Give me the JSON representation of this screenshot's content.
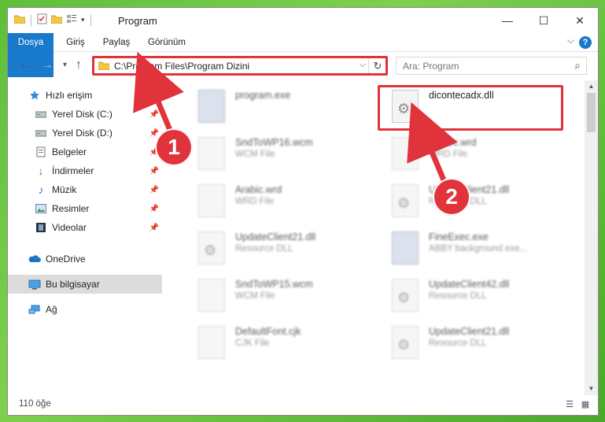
{
  "window": {
    "title": "Program",
    "controls": {
      "minimize": "—",
      "maximize": "☐",
      "close": "✕"
    }
  },
  "ribbon": {
    "tabs": [
      "Dosya",
      "Giriş",
      "Paylaş",
      "Görünüm"
    ],
    "help": "?",
    "expand_chevron": "⌵"
  },
  "navigation": {
    "address_path": "C:\\Program Files\\Program Dizini",
    "search_placeholder": "Ara: Program"
  },
  "sidebar": {
    "items": [
      {
        "label": "Hızlı erişim",
        "icon": "star-icon",
        "pinned": false
      },
      {
        "label": "Yerel Disk (C:)",
        "icon": "drive-icon",
        "pinned": true
      },
      {
        "label": "Yerel Disk (D:)",
        "icon": "drive-icon",
        "pinned": true
      },
      {
        "label": "Belgeler",
        "icon": "document-icon",
        "pinned": true
      },
      {
        "label": "İndirmeler",
        "icon": "download-icon",
        "pinned": true
      },
      {
        "label": "Müzik",
        "icon": "music-icon",
        "pinned": true
      },
      {
        "label": "Resimler",
        "icon": "picture-icon",
        "pinned": true
      },
      {
        "label": "Videolar",
        "icon": "video-icon",
        "pinned": true
      },
      {
        "label": "OneDrive",
        "icon": "cloud-icon",
        "pinned": false
      },
      {
        "label": "Bu bilgisayar",
        "icon": "computer-icon",
        "pinned": false,
        "selected": true
      },
      {
        "label": "Ağ",
        "icon": "network-icon",
        "pinned": false
      }
    ]
  },
  "files": [
    {
      "name": "program.exe",
      "type": "",
      "icon": "exe-icon",
      "blurred": true
    },
    {
      "name": "dicontecadx.dll",
      "type": "",
      "icon": "dll-gear-icon",
      "blurred": false,
      "highlighted": true
    },
    {
      "name": "SndToWP16.wcm",
      "type": "WCM File",
      "icon": "blank-file-icon",
      "blurred": true
    },
    {
      "name": "Mexec.wrd",
      "type": "WRD File",
      "icon": "blank-file-icon",
      "blurred": true
    },
    {
      "name": "Arabic.wrd",
      "type": "WRD File",
      "icon": "blank-file-icon",
      "blurred": true
    },
    {
      "name": "UpdateClient21.dll",
      "type": "Resource DLL",
      "icon": "dll-gear-icon",
      "blurred": true
    },
    {
      "name": "UpdateClient21.dll",
      "type": "Resource DLL",
      "icon": "dll-gear-icon",
      "blurred": true
    },
    {
      "name": "FineExec.exe",
      "type": "ABBY background exe...",
      "icon": "exe-icon",
      "blurred": true
    },
    {
      "name": "SndToWP15.wcm",
      "type": "WCM File",
      "icon": "blank-file-icon",
      "blurred": true
    },
    {
      "name": "UpdateClient42.dll",
      "type": "Resource DLL",
      "icon": "dll-gear-icon",
      "blurred": true
    },
    {
      "name": "DefaultFont.cjk",
      "type": "CJK File",
      "icon": "blank-file-icon",
      "blurred": true
    },
    {
      "name": "UpdateClient21.dll",
      "type": "Resource DLL",
      "icon": "dll-gear-icon",
      "blurred": true
    }
  ],
  "status": {
    "item_count": "110 öğe"
  },
  "annotations": {
    "step1": "1",
    "step2": "2",
    "color": "#e0333b"
  }
}
